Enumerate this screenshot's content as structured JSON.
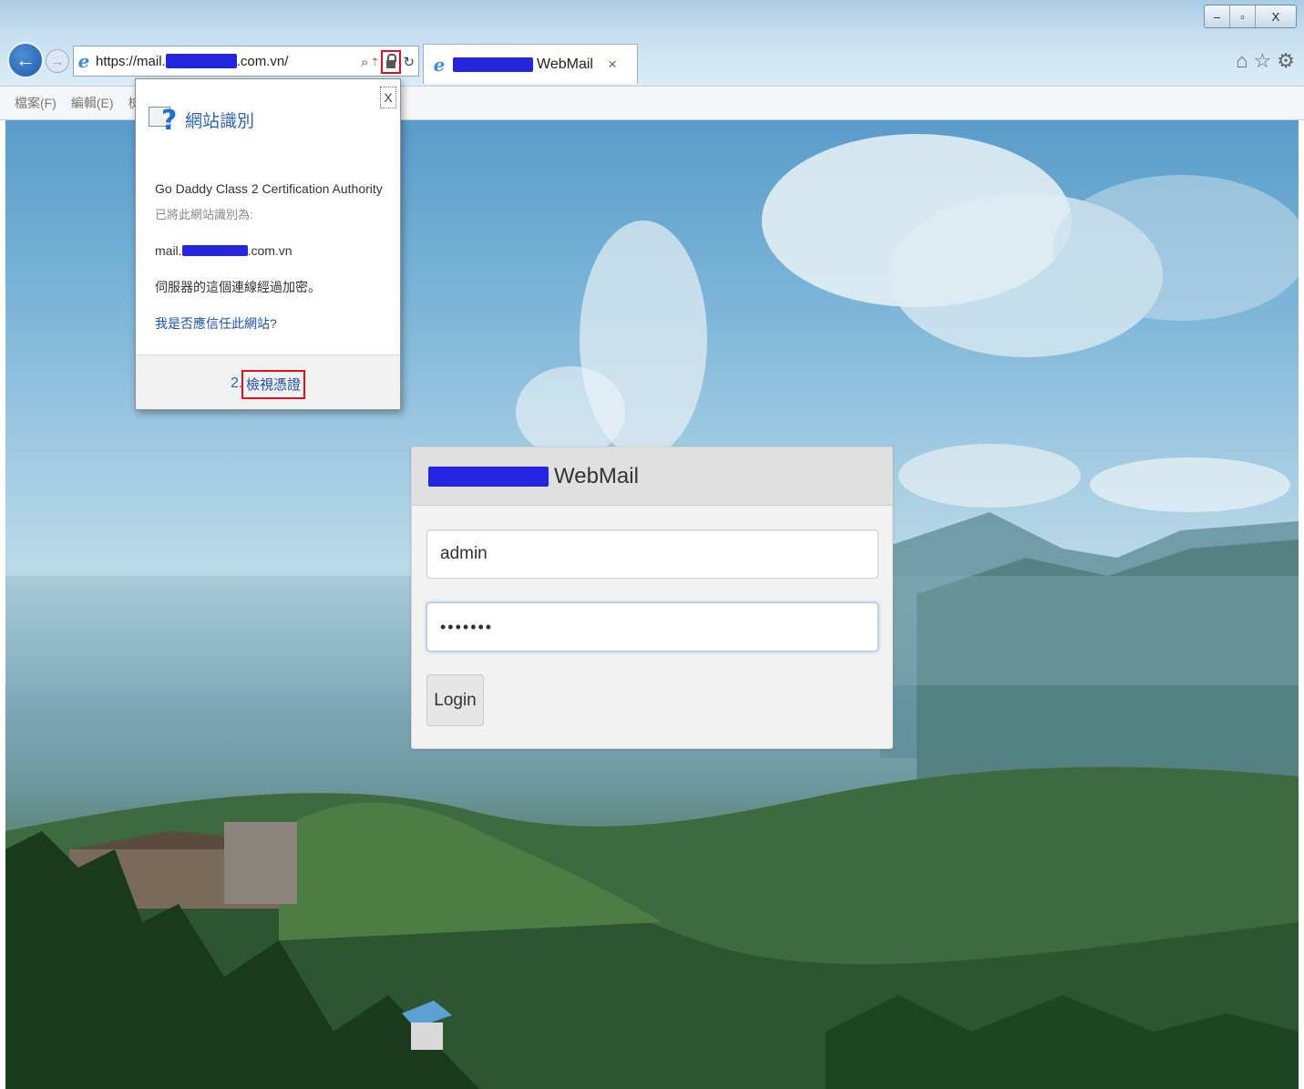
{
  "browser": {
    "url_prefix": "https://mail.",
    "url_suffix": ".com.vn/",
    "tab_title": "WebMail",
    "tab_close": "×",
    "window_buttons": [
      "–",
      "▫",
      "X"
    ],
    "back_icon": "←",
    "forward_icon": "→",
    "search_icon": "⌕",
    "refresh_icon": "↻",
    "right_icons": {
      "home": "⌂",
      "favorites": "☆",
      "settings": "⚙"
    }
  },
  "menubar": {
    "file": "檔案(F)",
    "edit": "編輯(E)",
    "view": "檢視"
  },
  "popup": {
    "title": "網站識別",
    "authority": "Go Daddy Class 2 Certification Authority",
    "identified_as": "已將此網站識別為:",
    "domain_prefix": "mail.",
    "domain_suffix": ".com.vn",
    "encrypted": "伺服器的這個連線經過加密。",
    "trust_link": "我是否應信任此網站?",
    "step_number": "2.",
    "view_cert": "檢視憑證",
    "close": "X"
  },
  "login": {
    "header_title": "WebMail",
    "username_value": "admin",
    "password_value": "•••••••",
    "login_button": "Login"
  },
  "colors": {
    "redaction": "#2525e0",
    "highlight": "#e0101c",
    "link": "#1d4fb0"
  }
}
